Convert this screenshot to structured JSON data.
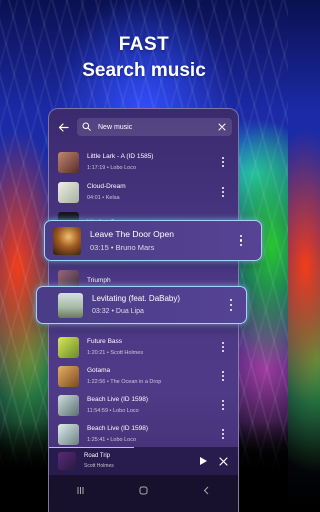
{
  "headline": {
    "line1": "FAST",
    "line2": "Search music"
  },
  "search": {
    "query": "New music",
    "icons": [
      "arrow-left-icon",
      "search-icon",
      "close-icon"
    ]
  },
  "songs": [
    {
      "title": "Little Lark - A (ID 1585)",
      "duration": "1:17:19",
      "artist": "Lobo Loco",
      "art_color": "#8a5a4a"
    },
    {
      "title": "Cloud-Dream",
      "duration": "04:01",
      "artist": "Kelsa",
      "art_color": "#d8dccc"
    },
    {
      "title": "We Are One",
      "duration": "",
      "artist": "",
      "art_color": "#1a1a22"
    },
    {
      "title": "Triumph",
      "duration": "",
      "artist": "",
      "art_color": "#6a4a5a"
    },
    {
      "title": "Future Bass",
      "duration": "1:20:21",
      "artist": "Scott Holmes",
      "art_color": "#b8d04a"
    },
    {
      "title": "Gotama",
      "duration": "1:22:56",
      "artist": "The Ocean in a Drop",
      "art_color": "#c89040"
    },
    {
      "title": "Beach Live (ID 1598)",
      "duration": "11:54:59",
      "artist": "Lobo Loco",
      "art_color": "#8aa0a0"
    },
    {
      "title": "Beach Live (ID 1598)",
      "duration": "1:25:41",
      "artist": "Lobo Loco",
      "art_color": "#9ab0b0"
    }
  ],
  "highlight_cards": [
    {
      "title": "Leave The Door Open",
      "duration": "03:15",
      "artist": "Bruno Mars",
      "art_color": "#c08030"
    },
    {
      "title": "Levitating (feat. DaBaby)",
      "duration": "03:32",
      "artist": "Dua Lipa",
      "art_color": "#a0b4a0"
    }
  ],
  "now_playing": {
    "title": "Road Trip",
    "artist": "Scott Holmes",
    "progress": 0.45
  },
  "separator": "•",
  "colors": {
    "panel": "#4a3784",
    "card_glow": "#aadcff",
    "accent": "#c9b8ff"
  }
}
